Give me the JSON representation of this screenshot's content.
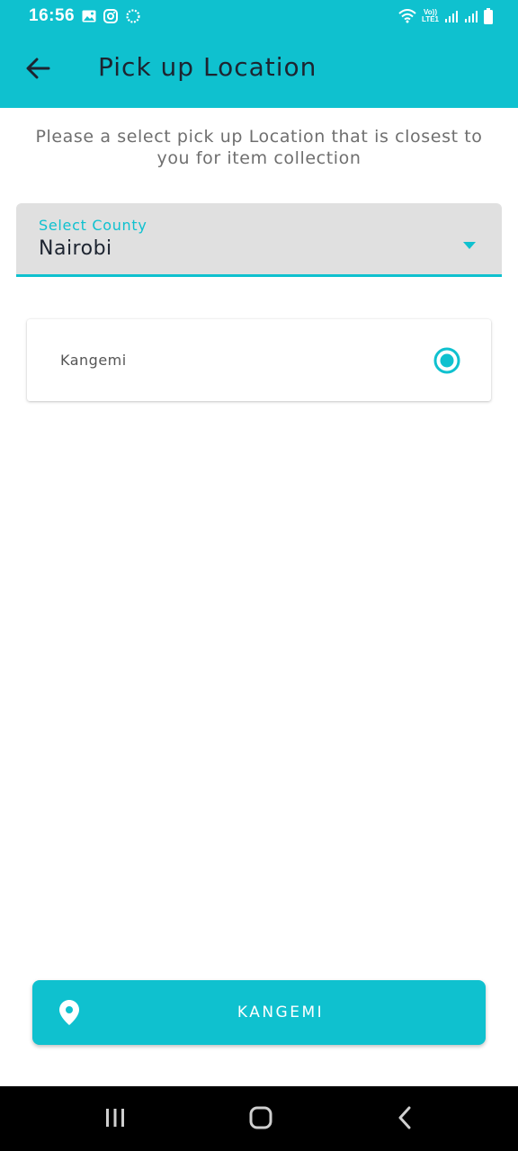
{
  "status_bar": {
    "time": "16:56",
    "left_icons": [
      "image-icon",
      "instagram-icon",
      "sync-icon"
    ],
    "volte_line1": "Vo))",
    "volte_line2": "LTE1",
    "right_icons": [
      "wifi-icon",
      "signal-icon",
      "signal-icon",
      "battery-icon"
    ]
  },
  "app_bar": {
    "title": "Pick up Location",
    "back_icon": "arrow-left-icon"
  },
  "instruction": "Please a select pick up Location that is closest to you for item collection",
  "county_select": {
    "label": "Select County",
    "value": "Nairobi",
    "icon": "caret-down-icon"
  },
  "locations": [
    {
      "name": "Kangemi",
      "selected": true
    }
  ],
  "confirm_button": {
    "label": "KANGEMI",
    "icon": "location-pin-icon"
  },
  "nav_bar": {
    "icons": [
      "recent-apps-icon",
      "home-icon",
      "back-icon"
    ]
  },
  "colors": {
    "accent": "#0fc1cf",
    "select_background": "#e0e0e0",
    "title_text": "#1d2430",
    "muted_text": "#6f6f6f"
  }
}
